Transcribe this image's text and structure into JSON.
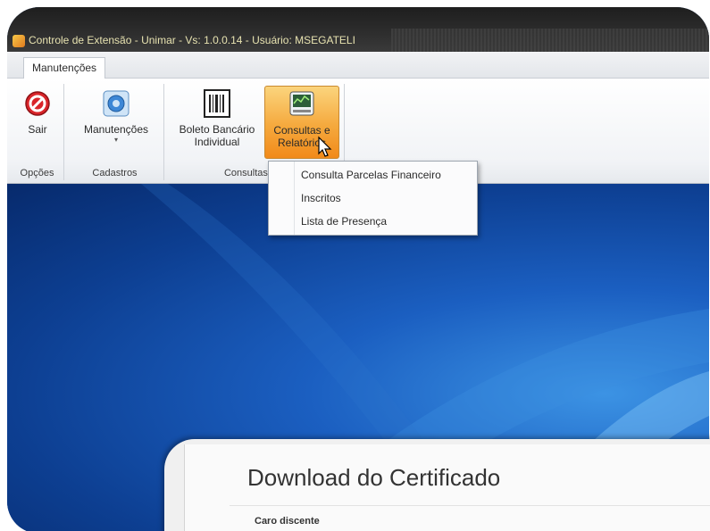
{
  "window": {
    "title": "Controle de Extensão - Unimar - Vs: 1.0.0.14 - Usuário: MSEGATELI"
  },
  "ribbon": {
    "tab": "Manutenções",
    "groups": [
      {
        "label": "Opções",
        "buttons": [
          {
            "label": "Sair"
          }
        ]
      },
      {
        "label": "Cadastros",
        "buttons": [
          {
            "label": "Manutenções"
          }
        ]
      },
      {
        "label": "Consultas e R",
        "buttons": [
          {
            "label_line1": "Boleto Bancário",
            "label_line2": "Individual"
          },
          {
            "label_line1": "Consultas e",
            "label_line2": "Relatórios"
          }
        ]
      }
    ]
  },
  "menu": {
    "items": [
      "Consulta Parcelas Financeiro",
      "Inscritos",
      "Lista de Presença"
    ]
  },
  "overlay": {
    "heading": "Download do Certificado",
    "subheading": "Caro discente"
  },
  "colors": {
    "active_button": "#f5a93d",
    "desktop": "#1b5fc1"
  }
}
